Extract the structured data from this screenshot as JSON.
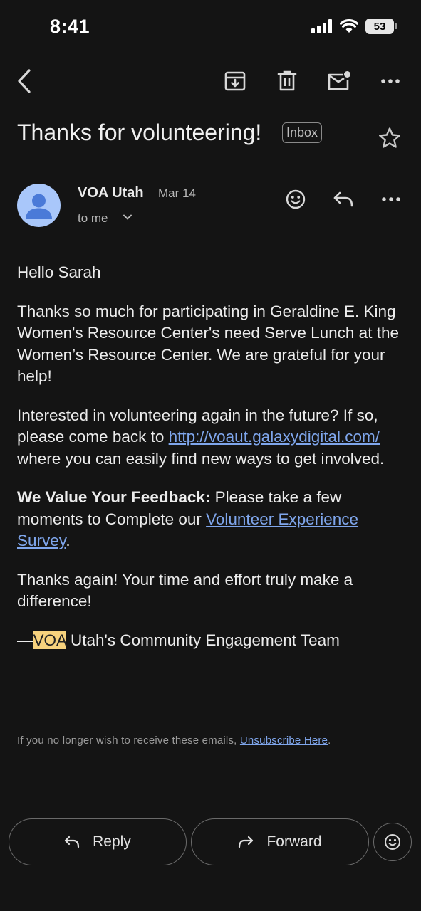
{
  "status_bar": {
    "time": "8:41",
    "battery": "53"
  },
  "toolbar": {
    "back_icon": "back-arrow-icon",
    "archive_icon": "archive-icon",
    "delete_icon": "trash-icon",
    "unread_icon": "mark-unread-icon",
    "more_icon": "more-icon"
  },
  "email": {
    "subject": "Thanks for volunteering!",
    "label": "Inbox",
    "sender": "VOA Utah",
    "date": "Mar 14",
    "recipient": "to me",
    "greeting": "Hello Sarah",
    "para1": "Thanks so much for participating in Geraldine E. King Women's Resource Center's need Serve Lunch at the Women’s Resource Center. We are grateful for your help!",
    "para2_pre": "Interested in volunteering again in the future? If so, please come back to ",
    "para2_link": "http://voaut.galaxydigital.com/",
    "para2_post": " where you can easily find new ways to get involved.",
    "para3_bold": "We Value Your Feedback:",
    "para3_pre": " Please take a few moments to Complete our ",
    "para3_link": "Volunteer Experience Survey",
    "para3_post": ".",
    "para4": "Thanks again! Your time and effort truly make a difference!",
    "sig_dash": "—",
    "sig_highlight": "VOA",
    "sig_rest": " Utah's Community Engagement Team",
    "footer_pre": "If you no longer wish to receive these emails, ",
    "footer_link": "Unsubscribe Here",
    "footer_post": "."
  },
  "actions": {
    "reply": "Reply",
    "forward": "Forward"
  },
  "colors": {
    "background": "#141414",
    "link": "#7fa6ec",
    "highlight": "#f7d27d",
    "avatar": "#a9c7fa"
  }
}
